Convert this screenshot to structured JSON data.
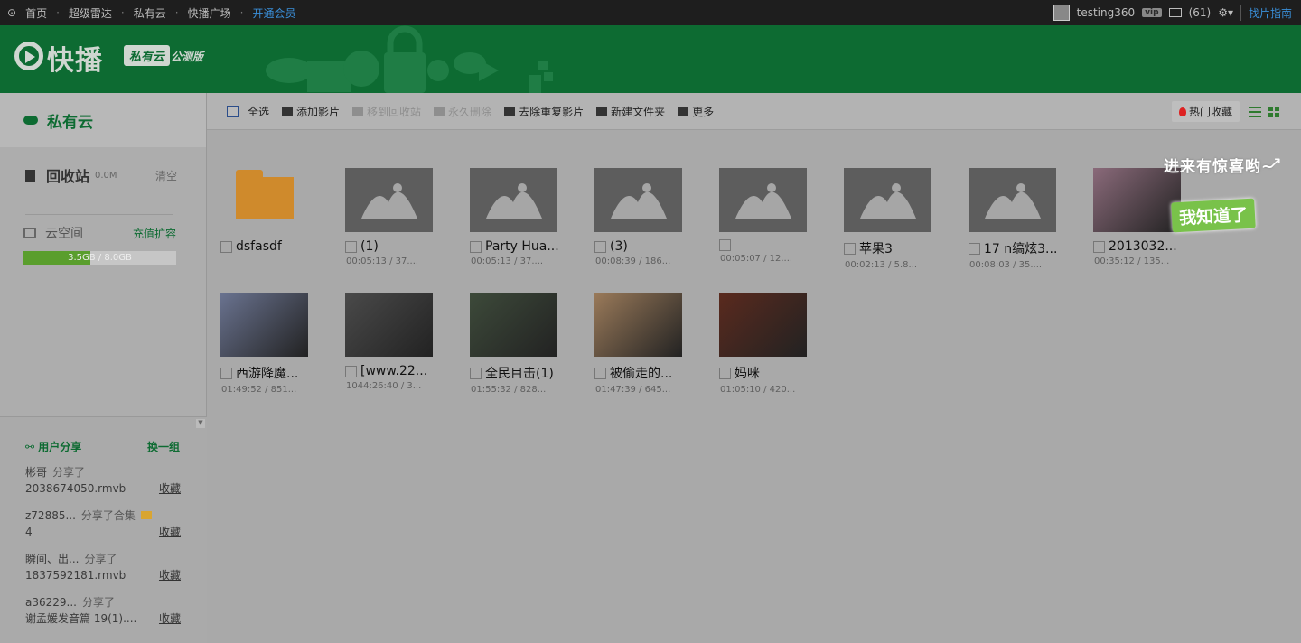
{
  "topnav": {
    "left": [
      "首页",
      "超级雷达",
      "私有云",
      "快播广场"
    ],
    "vip_link": "开通会员",
    "username": "testing360",
    "vip_badge": "vip",
    "messages": "(61)",
    "guide": "找片指南"
  },
  "banner": {
    "logo_text": "快播",
    "logo_badge": "私有云",
    "logo_sub": "公测版"
  },
  "sidebar": {
    "cloud_label": "私有云",
    "recycle_label": "回收站",
    "recycle_size": "0.0M",
    "clear_label": "清空",
    "space_label": "云空间",
    "recharge_label": "充值扩容",
    "quota_text": "3.5GB / 8.0GB",
    "quota_fraction": 0.4375
  },
  "share": {
    "title": "用户分享",
    "switch_label": "换一组",
    "items": [
      {
        "user": "彬哥",
        "action": "分享了",
        "file": "2038674050.rmvb",
        "collect": "收藏"
      },
      {
        "user": "z72885...",
        "action": "分享了合集",
        "file": "4",
        "collect": "收藏"
      },
      {
        "user": "瞬间、出...",
        "action": "分享了",
        "file": "1837592181.rmvb",
        "collect": "收藏"
      },
      {
        "user": "a36229...",
        "action": "分享了",
        "file": "谢孟媛发音篇 19(1)....",
        "collect": "收藏"
      }
    ]
  },
  "toolbar": {
    "select_all": "全选",
    "add_movie": "添加影片",
    "move_to_recycle": "移到回收站",
    "delete_forever": "永久删除",
    "dedupe": "去除重复影片",
    "new_folder": "新建文件夹",
    "more": "更多",
    "hot_collect": "热门收藏"
  },
  "files": [
    {
      "name": "dsfasdf",
      "meta": "",
      "type": "folder"
    },
    {
      "name": "(1)",
      "meta": "00:05:13 / 37....",
      "type": "placeholder"
    },
    {
      "name": "Party Hua...",
      "meta": "00:05:13 / 37....",
      "type": "placeholder"
    },
    {
      "name": "(3)",
      "meta": "00:08:39 / 186...",
      "type": "placeholder"
    },
    {
      "name": "",
      "meta": "00:05:07 / 12....",
      "type": "placeholder"
    },
    {
      "name": "苹果3",
      "meta": "00:02:13 / 5.8...",
      "type": "placeholder"
    },
    {
      "name": "17 n缟炫3...",
      "meta": "00:08:03 / 35....",
      "type": "placeholder"
    },
    {
      "name": "2013032...",
      "meta": "00:35:12 / 135...",
      "type": "video",
      "color": "#8a6a7a"
    },
    {
      "name": "西游降魔...",
      "meta": "01:49:52 / 851...",
      "type": "video",
      "color": "#6a7390"
    },
    {
      "name": "[www.22...",
      "meta": "1044:26:40 / 3...",
      "type": "video",
      "color": "#4a4a4a"
    },
    {
      "name": "全民目击(1)",
      "meta": "01:55:32 / 828...",
      "type": "video",
      "color": "#3d4a3a"
    },
    {
      "name": "被偷走的...",
      "meta": "01:47:39 / 645...",
      "type": "video",
      "color": "#9a7a5a"
    },
    {
      "name": "妈咪",
      "meta": "01:05:10 / 420...",
      "type": "video",
      "color": "#5a2a1e"
    }
  ],
  "tips": {
    "line1": "进来有惊喜哟~",
    "button": "我知道了"
  }
}
